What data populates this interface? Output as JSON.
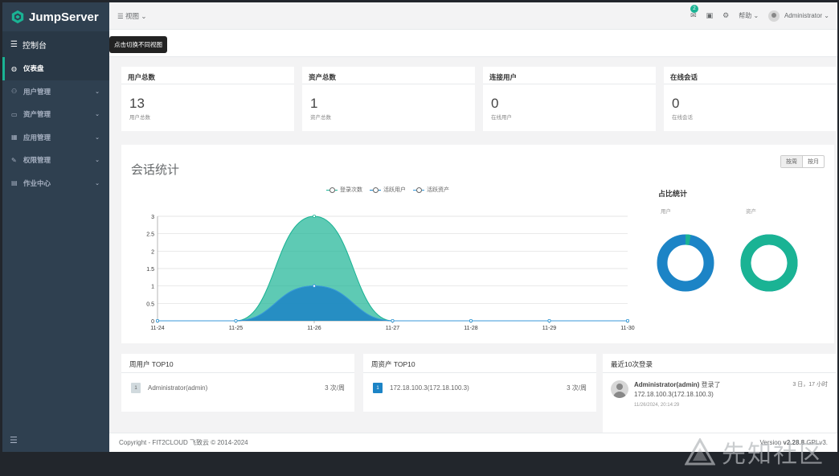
{
  "app": {
    "name": "JumpServer"
  },
  "sidebar": {
    "header": "控制台",
    "items": [
      {
        "label": "仪表盘",
        "icon": "dashboard-icon",
        "active": true
      },
      {
        "label": "用户管理",
        "icon": "users-icon"
      },
      {
        "label": "资产管理",
        "icon": "inbox-icon"
      },
      {
        "label": "应用管理",
        "icon": "grid-icon"
      },
      {
        "label": "权限管理",
        "icon": "edit-icon"
      },
      {
        "label": "作业中心",
        "icon": "terminal-icon"
      }
    ]
  },
  "topbar": {
    "view_label": "视图",
    "mail_badge": "2",
    "help_label": "帮助",
    "user_label": "Administrator"
  },
  "tooltip": "点击切换不同视图",
  "stats": [
    {
      "title": "用户总数",
      "value": "13",
      "sub": "用户总数"
    },
    {
      "title": "资产总数",
      "value": "1",
      "sub": "资产总数"
    },
    {
      "title": "连接用户",
      "value": "0",
      "sub": "在线用户"
    },
    {
      "title": "在线会话",
      "value": "0",
      "sub": "在线会话"
    }
  ],
  "session_panel": {
    "title": "会话统计",
    "seg_week": "按周",
    "seg_month": "按月",
    "ratio_title": "占比统计",
    "ratio_user_label": "用户",
    "ratio_asset_label": "资产"
  },
  "chart_data": {
    "type": "area",
    "categories": [
      "11-24",
      "11-25",
      "11-26",
      "11-27",
      "11-28",
      "11-29",
      "11-30"
    ],
    "series": [
      {
        "name": "登录次数",
        "values": [
          0,
          0,
          3,
          0,
          0,
          0,
          0
        ],
        "color": "#1ab394"
      },
      {
        "name": "活跃用户",
        "values": [
          0,
          0,
          1,
          0,
          0,
          0,
          0
        ],
        "color": "#1c84c6"
      },
      {
        "name": "活跃资产",
        "values": [
          0,
          0,
          1,
          0,
          0,
          0,
          0
        ],
        "color": "#3a9ad9"
      }
    ],
    "ylim": [
      0,
      3
    ],
    "yticks": [
      "0",
      "0.5",
      "1",
      "1.5",
      "2",
      "2.5",
      "3"
    ],
    "grid": true,
    "legend": "top-center"
  },
  "ratio": {
    "user_active_fraction": 0.03,
    "asset_active_fraction": 1.0
  },
  "top_users": {
    "title": "周用户 TOP10",
    "rows": [
      {
        "rank": "1",
        "name": "Administrator(admin)",
        "value": "3 次/周"
      }
    ]
  },
  "top_assets": {
    "title": "周资产 TOP10",
    "rows": [
      {
        "rank": "1",
        "name": "172.18.100.3(172.18.100.3)",
        "value": "3 次/周"
      }
    ]
  },
  "recent_logins": {
    "title": "最近10次登录",
    "items": [
      {
        "user": "Administrator(admin)",
        "action": "登录了",
        "asset": "172.18.100.3(172.18.100.3)",
        "time": "11/26/2024, 20:14:29",
        "ago": "3 日，17 小时"
      }
    ]
  },
  "footer": {
    "copyright": "Copyright - FIT2CLOUD 飞致云 © 2014-2024",
    "version_prefix": "Version ",
    "version": "v2.28.8",
    "license": " GPLv3."
  },
  "watermark": "先知社区",
  "colors": {
    "sidebar_bg": "#2f4050",
    "accent": "#1ab394",
    "blue": "#1c84c6"
  }
}
